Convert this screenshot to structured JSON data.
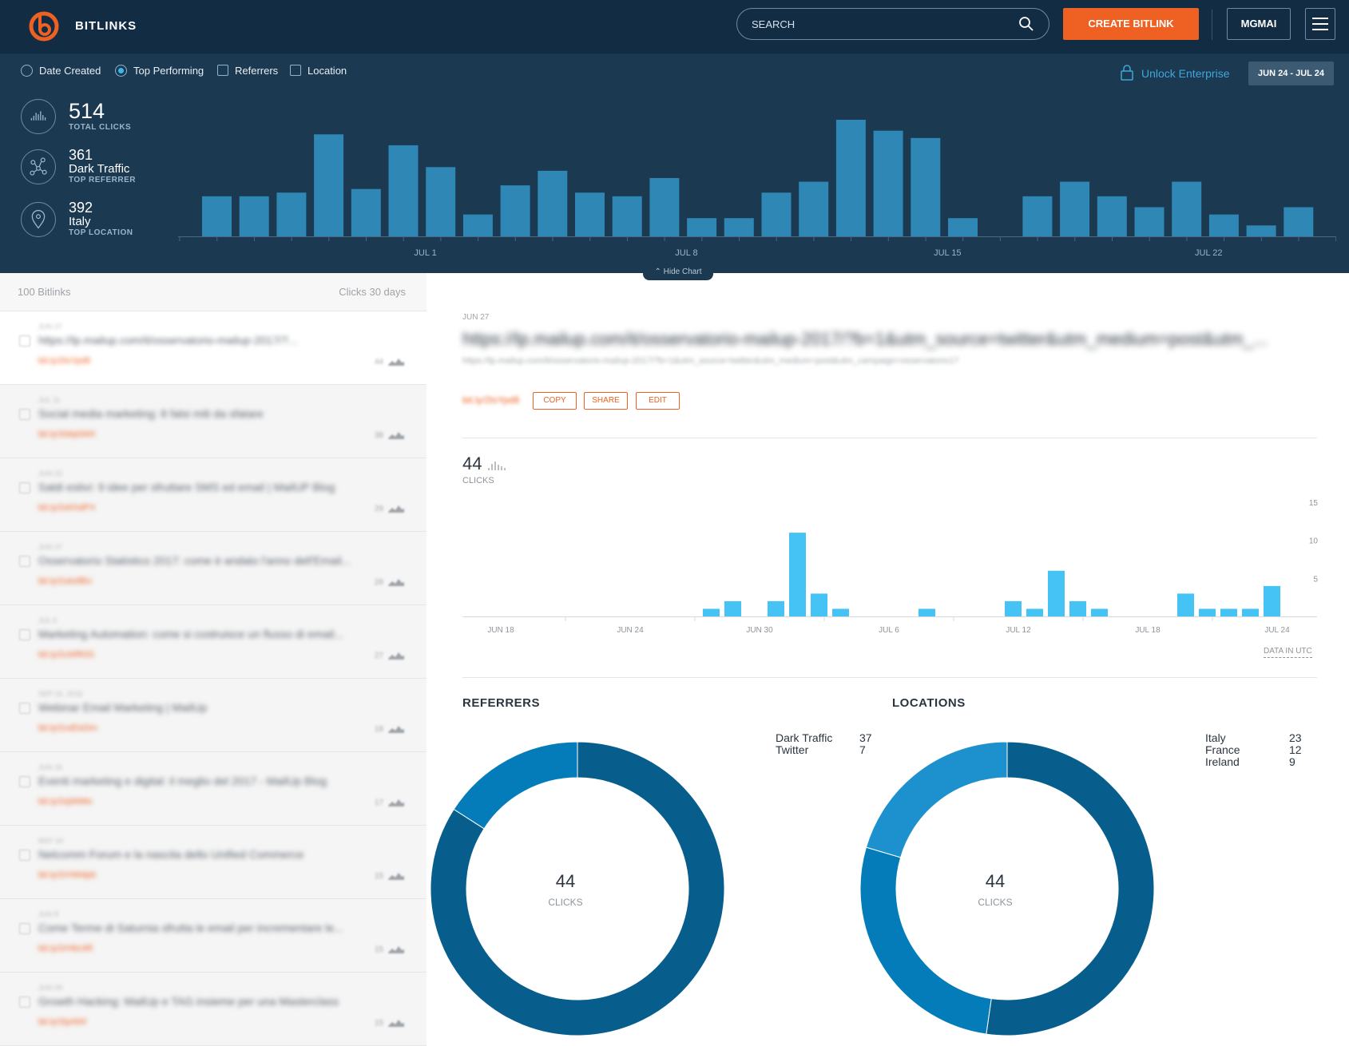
{
  "nav": {
    "brand": "BITLINKS",
    "search_placeholder": "SEARCH",
    "create_label": "CREATE BITLINK",
    "user_label": "MGMAI"
  },
  "filters": {
    "date_created": "Date Created",
    "top_performing": "Top Performing",
    "referrers": "Referrers",
    "location": "Location",
    "unlock": "Unlock Enterprise",
    "date_range": "JUN 24 - JUL 24"
  },
  "stats": {
    "total_clicks": "514",
    "total_clicks_label": "TOTAL CLICKS",
    "top_referrer_count": "361",
    "top_referrer_name": "Dark Traffic",
    "top_referrer_label": "TOP REFERRER",
    "top_location_count": "392",
    "top_location_name": "Italy",
    "top_location_label": "TOP LOCATION"
  },
  "hide_chart": "Hide Chart",
  "chart_data": [
    {
      "type": "bar",
      "x_tick_labels": [
        "JUL 1",
        "JUL 8",
        "JUL 15",
        "JUL 22"
      ],
      "values": [
        11,
        11,
        12,
        28,
        13,
        25,
        19,
        6,
        14,
        18,
        12,
        11,
        16,
        5,
        5,
        12,
        15,
        32,
        29,
        27,
        5,
        0,
        11,
        15,
        11,
        8,
        15,
        6,
        3,
        8
      ],
      "color": "#2e87b4"
    },
    {
      "type": "bar",
      "x_tick_labels": [
        "JUN 18",
        "JUN 24",
        "JUN 30",
        "JUL 6",
        "JUL 12",
        "JUL 18",
        "JUL 24"
      ],
      "y_ticks": [
        "15",
        "10",
        "5"
      ],
      "ylim": [
        0,
        15
      ],
      "values": [
        0,
        0,
        0,
        0,
        0,
        0,
        0,
        0,
        0,
        0,
        0,
        1,
        2,
        0,
        2,
        11,
        3,
        1,
        0,
        0,
        0,
        1,
        0,
        0,
        0,
        2,
        1,
        6,
        2,
        1,
        0,
        0,
        0,
        3,
        1,
        1,
        1,
        4,
        0,
        0,
        1,
        0
      ],
      "color": "#45c3f5"
    }
  ],
  "list": {
    "count_label": "100 Bitlinks",
    "clicks_label": "Clicks 30 days",
    "items": [
      {
        "date": "JUN 27",
        "title": "https://lp.mailup.com/it/osservatorio-mailup-2017/?...",
        "link": "bit.ly/2tsYpd8",
        "clicks": "44"
      },
      {
        "date": "JUL 11",
        "title": "Social media marketing: 8 falsi miti da sfatare",
        "link": "bit.ly/2tdqGMX",
        "clicks": "38"
      },
      {
        "date": "JUN 22",
        "title": "Saldi estivi: 9 idee per sfruttare SMS ed email | MailUP Blog",
        "link": "bit.ly/2sKhdPX",
        "clicks": "29"
      },
      {
        "date": "JUN 27",
        "title": "Osservatorio Statistico 2017: come è andato l'anno dell'Email...",
        "link": "bit.ly/2uksfBU",
        "clicks": "28"
      },
      {
        "date": "JUL 6",
        "title": "Marketing Automation: come si costruisce un flusso di email...",
        "link": "bit.ly/2uWfKtG",
        "clicks": "27"
      },
      {
        "date": "SEP 15, 2016",
        "title": "Webinar Email Marketing | MailUp",
        "link": "bit.ly/2cdDsDm",
        "clicks": "18"
      },
      {
        "date": "JUN 15",
        "title": "Eventi marketing e digital: il meglio del 2017 - MailUp Blog",
        "link": "bit.ly/2sjWMtv",
        "clicks": "17"
      },
      {
        "date": "MAY 24",
        "title": "Netcomm Forum e la nascita dello Unified Commerce",
        "link": "bit.ly/2rHWdpb",
        "clicks": "15"
      },
      {
        "date": "JUN 8",
        "title": "Come Terme di Saturnia sfrutta le email per incrementare le...",
        "link": "bit.ly/2rHbUtR",
        "clicks": "15"
      },
      {
        "date": "JUN 29",
        "title": "Growth Hacking: MailUp e TAG insieme per una Masterclass",
        "link": "bit.ly/2tprbhf",
        "clicks": "15"
      }
    ]
  },
  "detail": {
    "date": "JUN 27",
    "title": "https://lp.mailup.com/it/osservatorio-mailup-2017/?b=1&utm_source=twitter&utm_medium=post&utm_...",
    "long_url": "https://lp.mailup.com/it/osservatorio-mailup-2017/?b=1&utm_source=twitter&utm_medium=post&utm_campaign=osservatorio17",
    "short_link": "bit.ly/2tsYpd8",
    "copy": "COPY",
    "share": "SHARE",
    "edit": "EDIT",
    "clicks": "44",
    "clicks_label": "CLICKS",
    "utc": "DATA IN UTC"
  },
  "referrers": {
    "title": "REFERRERS",
    "total": "44",
    "total_label": "CLICKS",
    "items": [
      {
        "name": "Dark Traffic",
        "value": "37",
        "amount": 37,
        "color": "#075e8d"
      },
      {
        "name": "Twitter",
        "value": "7",
        "amount": 7,
        "color": "#047cb9"
      }
    ]
  },
  "locations": {
    "title": "LOCATIONS",
    "total": "44",
    "total_label": "CLICKS",
    "items": [
      {
        "name": "Italy",
        "value": "23",
        "amount": 23,
        "color": "#075e8d"
      },
      {
        "name": "France",
        "value": "12",
        "amount": 12,
        "color": "#047cb9"
      },
      {
        "name": "Ireland",
        "value": "9",
        "amount": 9,
        "color": "#1d91cd"
      }
    ]
  }
}
